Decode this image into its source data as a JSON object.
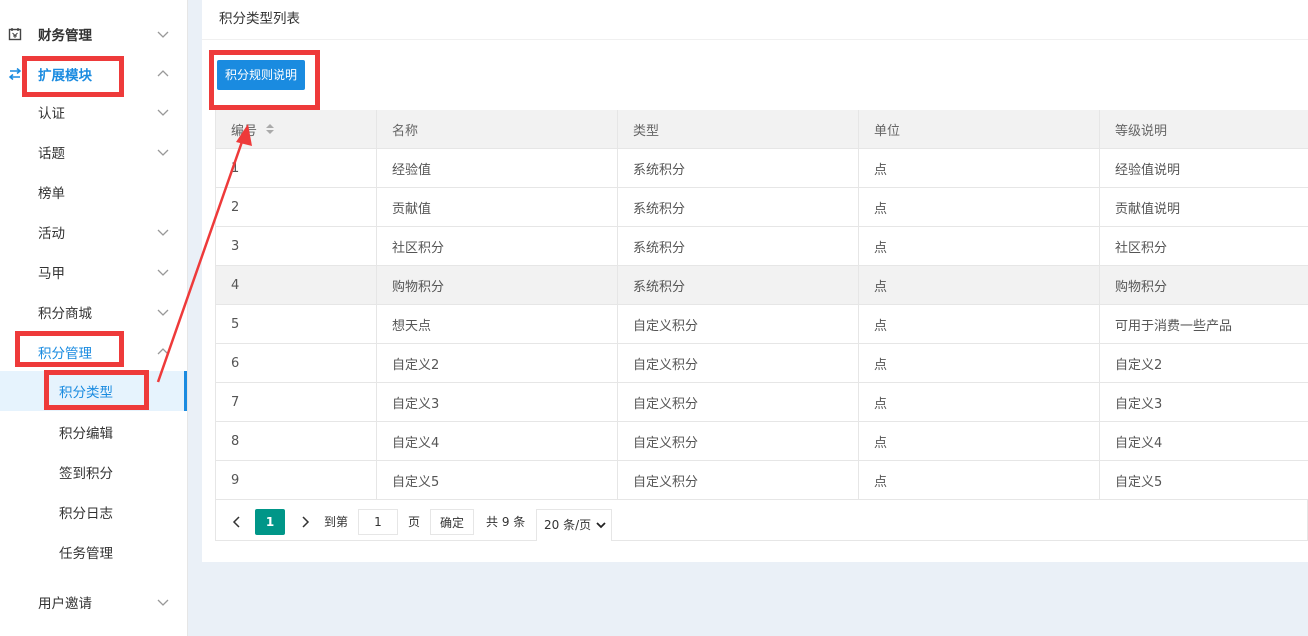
{
  "sidebar": {
    "items": [
      {
        "label": "财务管理",
        "level": 0,
        "icon": "calendar-icon"
      },
      {
        "label": "扩展模块",
        "level": 0,
        "icon": "swap-icon"
      },
      {
        "label": "认证",
        "level": 1
      },
      {
        "label": "话题",
        "level": 1
      },
      {
        "label": "榜单",
        "level": 1
      },
      {
        "label": "活动",
        "level": 1
      },
      {
        "label": "马甲",
        "level": 1
      },
      {
        "label": "积分商城",
        "level": 1
      },
      {
        "label": "积分管理",
        "level": 1
      },
      {
        "label": "积分类型",
        "level": 2
      },
      {
        "label": "积分编辑",
        "level": 2
      },
      {
        "label": "签到积分",
        "level": 2
      },
      {
        "label": "积分日志",
        "level": 2
      },
      {
        "label": "任务管理",
        "level": 2
      },
      {
        "label": "用户邀请",
        "level": 1
      }
    ]
  },
  "main": {
    "title": "积分类型列表",
    "rules_button": "积分规则说明",
    "table": {
      "headers": [
        "编号",
        "名称",
        "类型",
        "单位",
        "等级说明"
      ],
      "rows": [
        [
          "1",
          "经验值",
          "系统积分",
          "点",
          "经验值说明"
        ],
        [
          "2",
          "贡献值",
          "系统积分",
          "点",
          "贡献值说明"
        ],
        [
          "3",
          "社区积分",
          "系统积分",
          "点",
          "社区积分"
        ],
        [
          "4",
          "购物积分",
          "系统积分",
          "点",
          "购物积分"
        ],
        [
          "5",
          "想天点",
          "自定义积分",
          "点",
          "可用于消费一些产品"
        ],
        [
          "6",
          "自定义2",
          "自定义积分",
          "点",
          "自定义2"
        ],
        [
          "7",
          "自定义3",
          "自定义积分",
          "点",
          "自定义3"
        ],
        [
          "8",
          "自定义4",
          "自定义积分",
          "点",
          "自定义4"
        ],
        [
          "9",
          "自定义5",
          "自定义积分",
          "点",
          "自定义5"
        ]
      ]
    },
    "pagination": {
      "current": "1",
      "goto_prefix": "到第",
      "goto_value": "1",
      "goto_suffix": "页",
      "confirm": "确定",
      "total": "共 9 条",
      "page_size": "20 条/页"
    }
  },
  "colors": {
    "accent": "#1a8be0",
    "page_current": "#009688",
    "annotation": "#ee3a3a"
  }
}
